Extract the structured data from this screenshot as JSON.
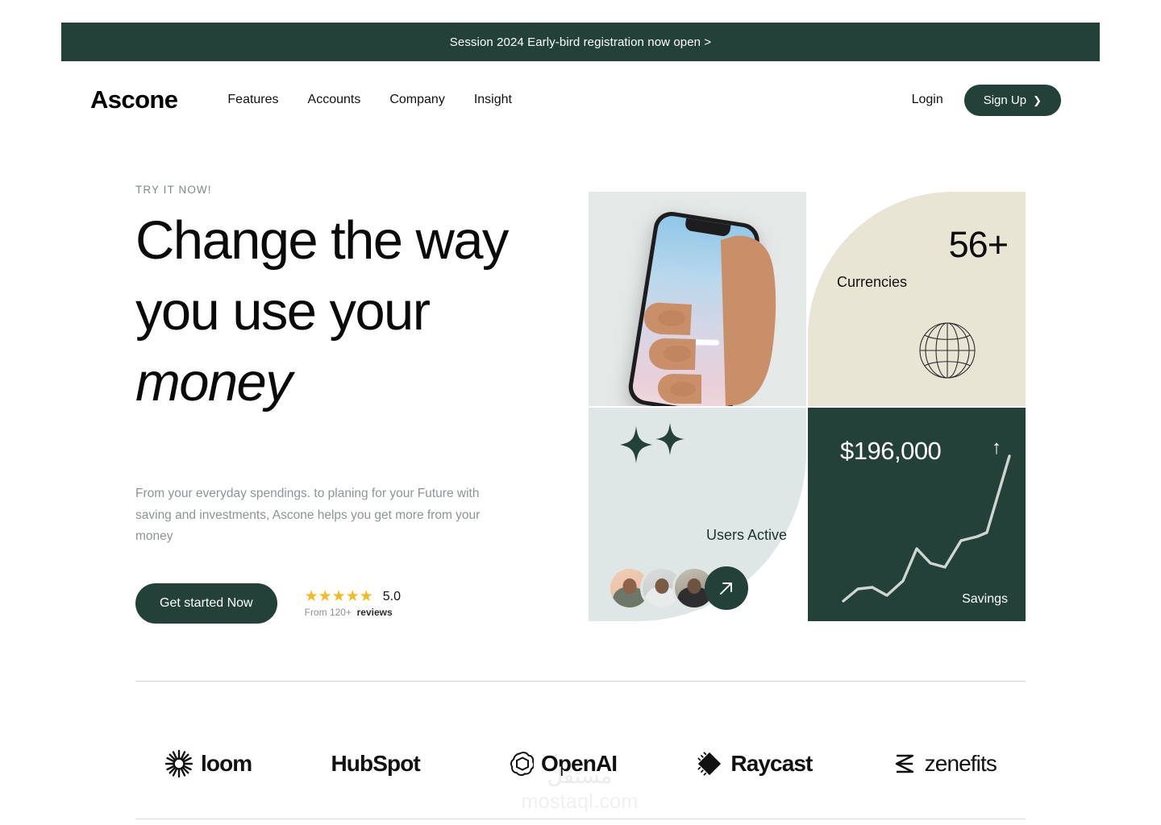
{
  "colors": {
    "dark_green": "#234039",
    "beige": "#E8E5D5",
    "mint": "#DEE7E5",
    "phone_bg": "#E4E8E7",
    "star_gold": "#F5B921",
    "muted_text": "#8E9496"
  },
  "announcement": {
    "text": "Session 2024 Early-bird registration now open >"
  },
  "nav": {
    "logo": "Ascone",
    "links": [
      {
        "label": "Features"
      },
      {
        "label": "Accounts"
      },
      {
        "label": "Company"
      },
      {
        "label": "Insight"
      }
    ],
    "login_label": "Login",
    "signup_label": "Sign Up",
    "signup_chevron": "❯"
  },
  "hero": {
    "eyebrow": "TRY IT NOW!",
    "headline_line1": "Change the way",
    "headline_line2": "you use your",
    "headline_line3_italic": "money",
    "paragraph": "From your everyday spendings. to planing for your Future with saving and investments, Ascone helps you get more from your money",
    "cta_label": "Get started Now",
    "rating": {
      "stars": "★★★★★",
      "score": "5.0",
      "from_text": "From 120+",
      "reviews_text": "reviews"
    }
  },
  "cards": {
    "phone": {
      "name": "hand-holding-phone-photo"
    },
    "currencies": {
      "number": "56+",
      "label": "Currencies",
      "icon": "globe-icon"
    },
    "users": {
      "label": "Users Active",
      "sparkle_icon": "sparkle-icon",
      "arrow_icon": "arrow-up-right-icon",
      "avatar_count": 3
    },
    "savings": {
      "amount": "$196,000",
      "arrow": "↑",
      "label": "Savings"
    }
  },
  "chart_data": {
    "type": "line",
    "title": "Savings",
    "x": [
      0,
      1,
      2,
      3,
      4,
      5,
      6,
      7,
      8,
      9,
      10,
      11
    ],
    "values": [
      8,
      16,
      17,
      13,
      22,
      44,
      36,
      34,
      52,
      56,
      60,
      98
    ],
    "series": [
      {
        "name": "Savings",
        "values": [
          8,
          16,
          17,
          13,
          22,
          44,
          36,
          34,
          52,
          56,
          60,
          98
        ]
      }
    ],
    "xlabel": "",
    "ylabel": "",
    "ylim": [
      0,
      100
    ],
    "grid": false,
    "legend": false,
    "annotation": "$196,000"
  },
  "logos": [
    {
      "name": "loom",
      "label": "loom",
      "icon": "loom-icon"
    },
    {
      "name": "hubspot",
      "label": "HubSpot",
      "icon": "hubspot-icon"
    },
    {
      "name": "openai",
      "label": "OpenAI",
      "icon": "openai-icon"
    },
    {
      "name": "raycast",
      "label": "Raycast",
      "icon": "raycast-icon"
    },
    {
      "name": "zenefits",
      "label": "zenefits",
      "icon": "zenefits-icon"
    }
  ],
  "watermark": {
    "arabic": "مستقل",
    "url": "mostaql.com"
  }
}
